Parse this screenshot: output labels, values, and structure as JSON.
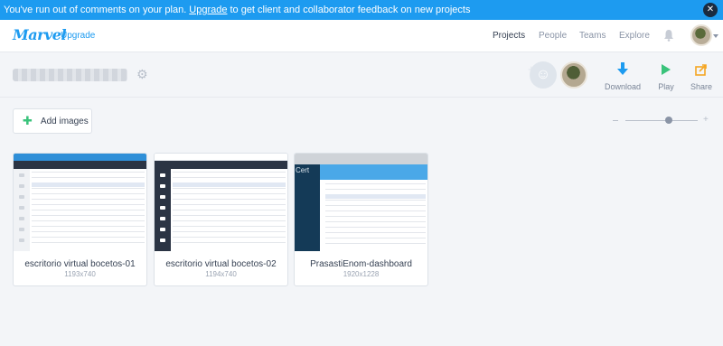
{
  "banner": {
    "text_before": "You've run out of comments on your plan.",
    "link": "Upgrade",
    "text_after": "to get client and collaborator feedback on new projects",
    "close_glyph": "✕"
  },
  "nav": {
    "logo": "Marvel",
    "upgrade": "Upgrade",
    "items": [
      "Projects",
      "People",
      "Teams",
      "Explore"
    ],
    "active": "Projects",
    "bell_icon": "bell-icon"
  },
  "project": {
    "settings_icon": "gear-icon",
    "actions": [
      {
        "label": "Download",
        "icon": "download-icon",
        "color": "#1d9bf0"
      },
      {
        "label": "Play",
        "icon": "play-icon",
        "color": "#3ac37b"
      },
      {
        "label": "Share",
        "icon": "share-icon",
        "color": "#f5a623"
      }
    ]
  },
  "toolbar": {
    "add_images": "Add images",
    "zoom_level": 0.6
  },
  "cards": [
    {
      "title": "escritorio virtual bocetos-01",
      "size": "1193x740"
    },
    {
      "title": "escritorio virtual bocetos-02",
      "size": "1194x740"
    },
    {
      "title": "PrasastiEnom-dashboard",
      "size": "1920x1228"
    }
  ],
  "colors": {
    "brand": "#1d9bf0",
    "banner": "#1d9bf0",
    "play": "#3ac37b",
    "share": "#f5a623"
  }
}
